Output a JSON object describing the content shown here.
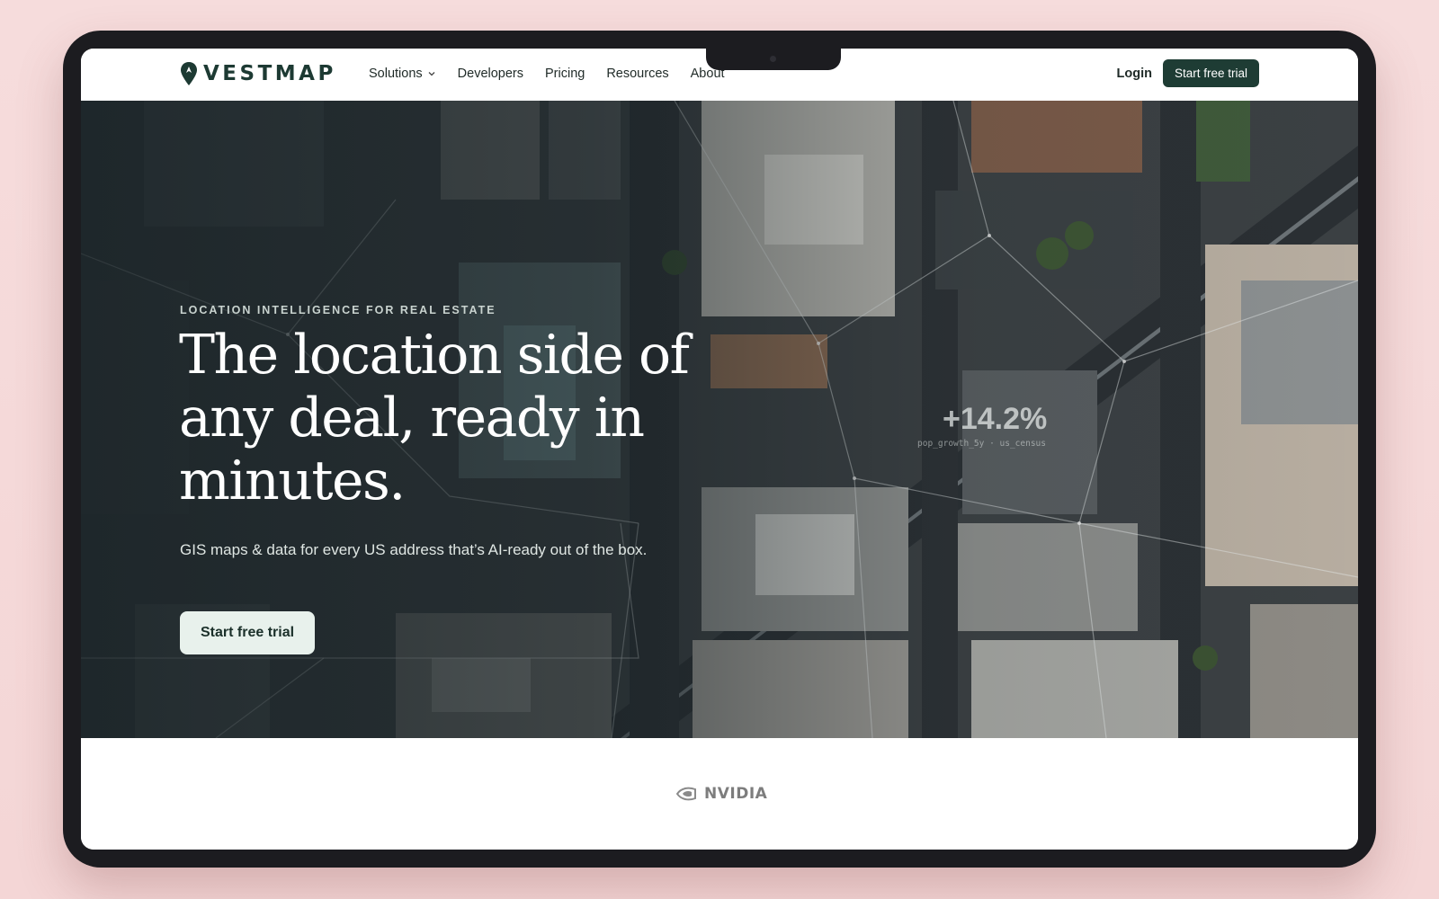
{
  "brand": {
    "name": "VESTMAP"
  },
  "nav": {
    "items": [
      {
        "label": "Solutions",
        "has_dropdown": true
      },
      {
        "label": "Developers",
        "has_dropdown": false
      },
      {
        "label": "Pricing",
        "has_dropdown": false
      },
      {
        "label": "Resources",
        "has_dropdown": false
      },
      {
        "label": "About",
        "has_dropdown": false
      }
    ],
    "login_label": "Login",
    "cta_label": "Start free trial"
  },
  "hero": {
    "eyebrow": "LOCATION INTELLIGENCE FOR REAL ESTATE",
    "headline": "The location side of any deal, ready in minutes.",
    "subline": "GIS maps & data for every US address that’s AI-ready out of the box.",
    "cta_label": "Start free trial",
    "stat": {
      "value": "+14.2%",
      "caption": "pop_growth_5y · us_census"
    }
  },
  "logos": {
    "items": [
      "NVIDIA"
    ]
  },
  "colors": {
    "accent": "#1e3c34",
    "cta_light": "#e8f1ec",
    "background": "#f4d6d6",
    "device": "#1c1c20"
  },
  "icons": {
    "logo": "map-pin-icon",
    "dropdown": "chevron-down-icon",
    "partner": "nvidia-eye-icon"
  }
}
